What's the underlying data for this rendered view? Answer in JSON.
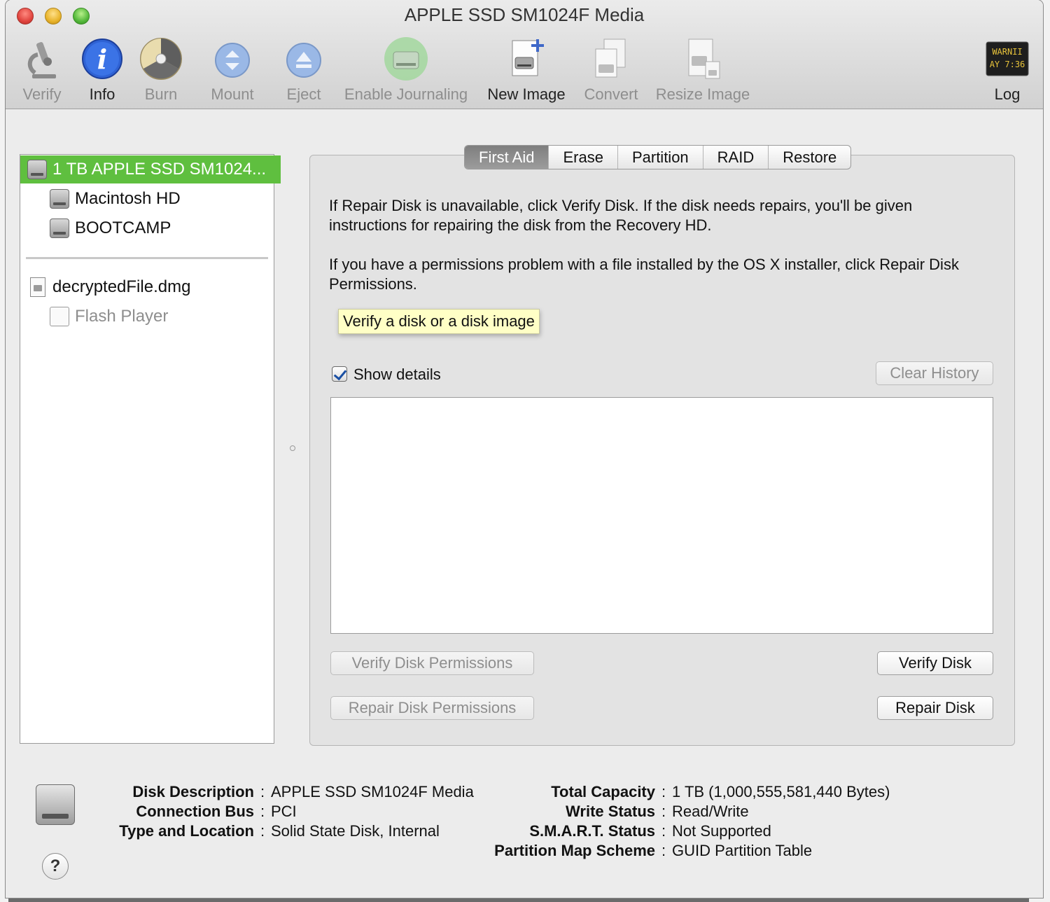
{
  "window": {
    "title": "APPLE SSD SM1024F Media"
  },
  "toolbar": {
    "items": [
      {
        "label": "Verify",
        "icon": "microscope-icon",
        "enabled": false
      },
      {
        "label": "Info",
        "icon": "info-icon",
        "enabled": true
      },
      {
        "label": "Burn",
        "icon": "burn-icon",
        "enabled": false
      },
      {
        "label": "Mount",
        "icon": "mount-icon",
        "enabled": false
      },
      {
        "label": "Eject",
        "icon": "eject-icon",
        "enabled": false
      },
      {
        "label": "Enable Journaling",
        "icon": "journaling-icon",
        "enabled": false
      },
      {
        "label": "New Image",
        "icon": "new-image-icon",
        "enabled": true
      },
      {
        "label": "Convert",
        "icon": "convert-icon",
        "enabled": false
      },
      {
        "label": "Resize Image",
        "icon": "resize-image-icon",
        "enabled": false
      },
      {
        "label": "Log",
        "icon": "log-console-icon",
        "enabled": true
      }
    ],
    "log_icon_text": [
      "WARNII",
      "AY 7:36"
    ]
  },
  "sidebar": {
    "items": [
      {
        "label": "1 TB APPLE SSD SM1024...",
        "icon": "hard-disk-icon",
        "selected": true
      },
      {
        "label": "Macintosh HD",
        "icon": "hard-disk-icon"
      },
      {
        "label": "BOOTCAMP",
        "icon": "hard-disk-icon"
      },
      {
        "label": "decryptedFile.dmg",
        "icon": "disk-image-icon"
      },
      {
        "label": "Flash Player",
        "icon": "volume-icon",
        "dimmed": true
      }
    ]
  },
  "tabs": [
    "First Aid",
    "Erase",
    "Partition",
    "RAID",
    "Restore"
  ],
  "first_aid": {
    "para1": "If Repair Disk is unavailable, click Verify Disk. If the disk needs repairs, you'll be given instructions for repairing the disk from the Recovery HD.",
    "para2": "If you have a permissions problem with a file installed by the OS X installer, click Repair Disk Permissions.",
    "tooltip": "Verify a disk or a disk image",
    "show_details_label": "Show details",
    "show_details_checked": true,
    "clear_history": "Clear History",
    "verify_permissions": "Verify Disk Permissions",
    "repair_permissions": "Repair Disk Permissions",
    "verify_disk": "Verify Disk",
    "repair_disk": "Repair Disk"
  },
  "info": {
    "left": [
      {
        "key": "Disk Description",
        "value": "APPLE SSD SM1024F Media"
      },
      {
        "key": "Connection Bus",
        "value": "PCI"
      },
      {
        "key": "Type and Location",
        "value": "Solid State Disk, Internal"
      }
    ],
    "right": [
      {
        "key": "Total Capacity",
        "value": "1 TB (1,000,555,581,440 Bytes)"
      },
      {
        "key": "Write Status",
        "value": "Read/Write"
      },
      {
        "key": "S.M.A.R.T. Status",
        "value": "Not Supported"
      },
      {
        "key": "Partition Map Scheme",
        "value": "GUID Partition Table"
      }
    ],
    "separator": ":",
    "help": "?"
  },
  "colors": {
    "selection": "#5fbf3f",
    "tooltip_bg": "#ffffc6",
    "info_icon": "#2f62d4"
  }
}
